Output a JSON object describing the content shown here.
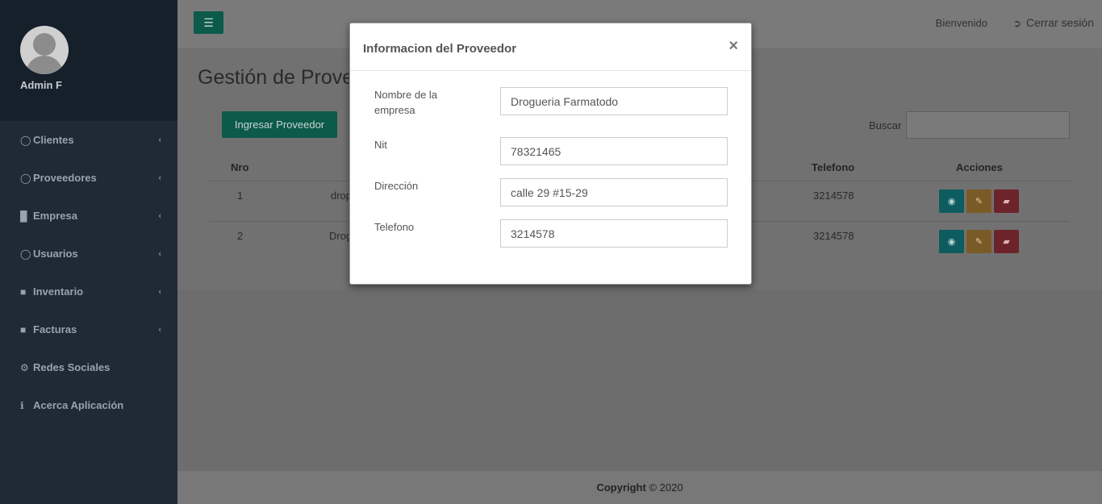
{
  "sidebar": {
    "user_name": "Admin F",
    "items": [
      {
        "label": "Clientes",
        "icon": "lock-icon",
        "glyph": "🔒"
      },
      {
        "label": "Proveedores",
        "icon": "lock-icon",
        "glyph": "🔒"
      },
      {
        "label": "Empresa",
        "icon": "building-icon",
        "glyph": "▆"
      },
      {
        "label": "Usuarios",
        "icon": "lock-icon",
        "glyph": "🔒"
      },
      {
        "label": "Inventario",
        "icon": "cart-icon",
        "glyph": "🛒"
      },
      {
        "label": "Facturas",
        "icon": "cart-icon",
        "glyph": "🛒"
      },
      {
        "label": "Redes Sociales",
        "icon": "gear-icon",
        "glyph": "⚙"
      },
      {
        "label": "Acerca Aplicación",
        "icon": "info-icon",
        "glyph": "ℹ"
      }
    ]
  },
  "header": {
    "welcome": "Bienvenido",
    "logout": "Cerrar sesión"
  },
  "main": {
    "page_title": "Gestión de Proveedores",
    "add_button": "Ingresar Proveedor",
    "search_label": "Buscar",
    "table": {
      "headers": {
        "nro": "Nro",
        "telefono": "Telefono",
        "acciones": "Acciones"
      },
      "rows": [
        {
          "nro": "1",
          "nombre": "drop",
          "telefono": "3214578"
        },
        {
          "nro": "2",
          "nombre": "Drog",
          "telefono": "3214578"
        }
      ]
    }
  },
  "modal": {
    "title": "Informacion del Proveedor",
    "close": "×",
    "fields": [
      {
        "label": "Nombre de la empresa",
        "value": "Drogueria Farmatodo"
      },
      {
        "label": "Nit",
        "value": "78321465"
      },
      {
        "label": "Dirección",
        "value": "calle 29 #15-29"
      },
      {
        "label": "Telefono",
        "value": "3214578"
      }
    ]
  },
  "footer": {
    "copyright_bold": "Copyright",
    "copyright_rest": " © 2020"
  },
  "colors": {
    "sidebar_bg": "#1f2a36",
    "primary": "#16a085",
    "info": "#17a2b8",
    "warning": "#f0a030",
    "danger": "#dc3545"
  }
}
